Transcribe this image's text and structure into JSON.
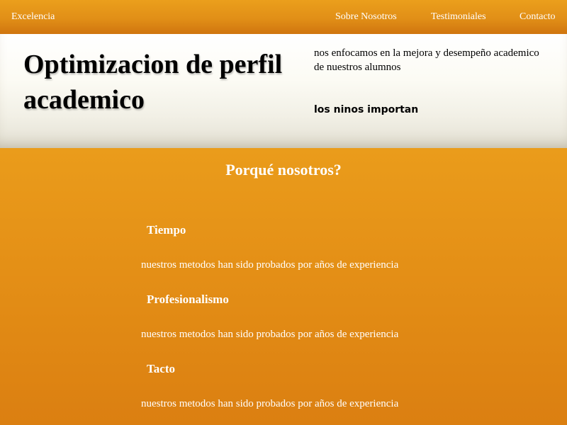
{
  "nav": {
    "brand": "Excelencia",
    "links": [
      "Sobre Nosotros",
      "Testimoniales",
      "Contacto"
    ]
  },
  "hero": {
    "title": "Optimizacion de perfil academico",
    "description": "nos enfocamos en la mejora y desempeño academico de nuestros alumnos",
    "tagline": "los ninos importan"
  },
  "section": {
    "title": "Porqué nosotros?",
    "features": [
      {
        "title": "Tiempo",
        "text": "nuestros metodos han sido probados por años de experiencia"
      },
      {
        "title": "Profesionalismo",
        "text": "nuestros metodos han sido probados por años de experiencia"
      },
      {
        "title": "Tacto",
        "text": "nuestros metodos han sido probados por años de experiencia"
      }
    ]
  },
  "colors": {
    "nav_orange": "#e8981b",
    "section_orange": "#e48f16",
    "hero_background": "#fcfbf4",
    "text_light": "#ffffff",
    "text_dark": "#000000"
  }
}
